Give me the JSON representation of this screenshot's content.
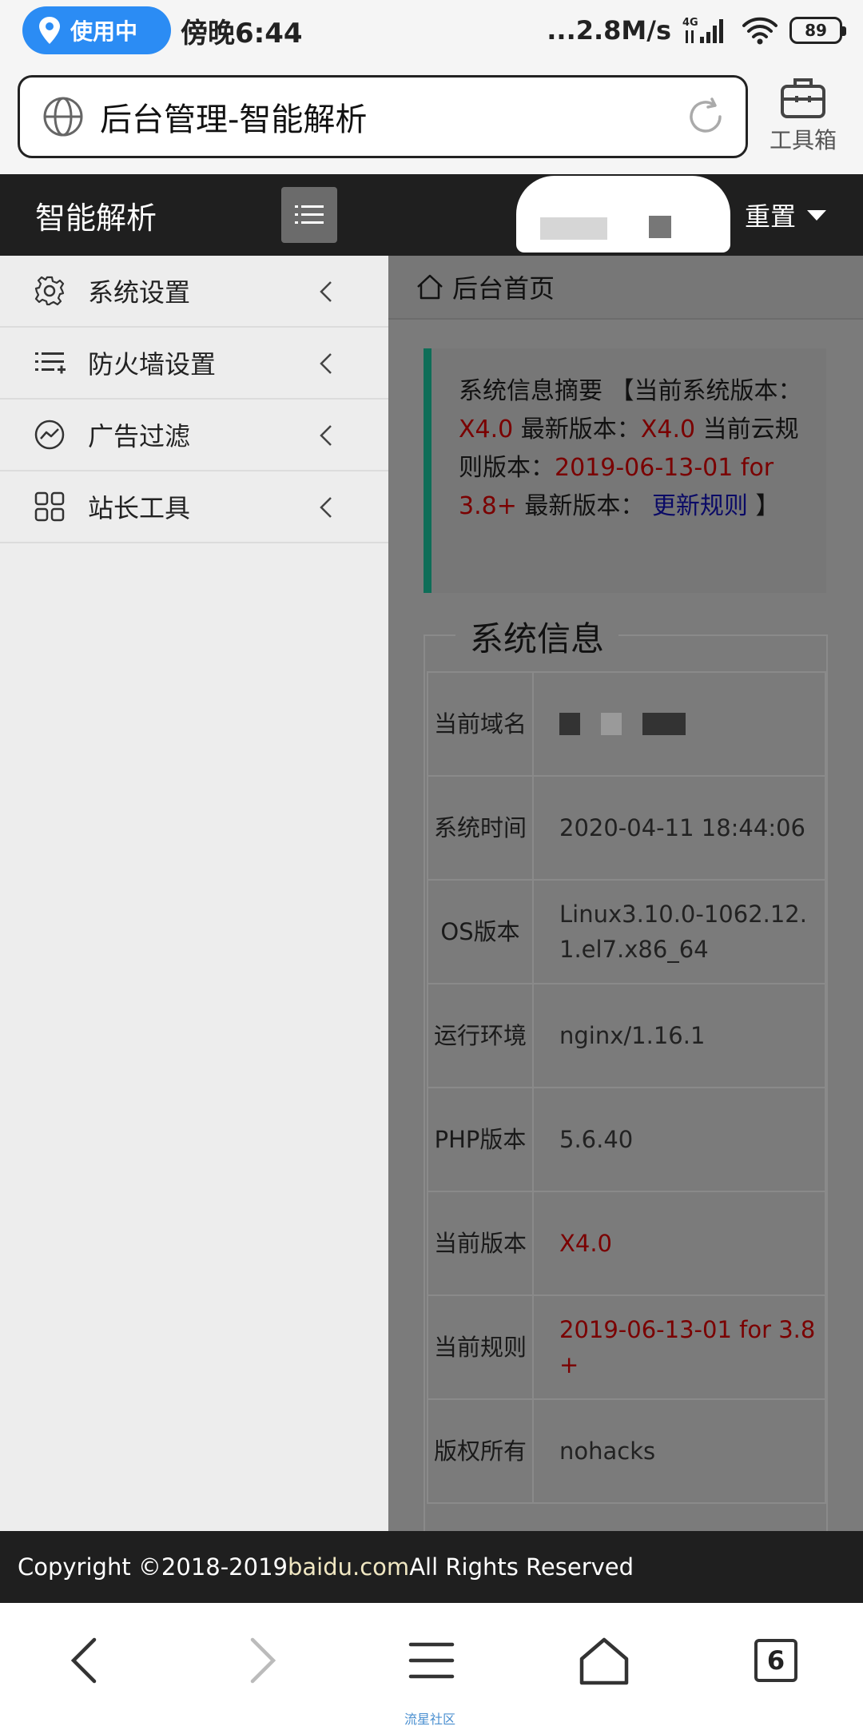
{
  "status_bar": {
    "location_label": "使用中",
    "time": "傍晚6:44",
    "network_speed": "...2.8M/s",
    "network_type": "4G",
    "battery": "89"
  },
  "browser": {
    "page_title": "后台管理-智能解析",
    "toolbox_label": "工具箱",
    "tabs_count": "6",
    "watermark": "流星社区"
  },
  "header": {
    "brand": "智能解析",
    "reset_label": "重置"
  },
  "sidebar": {
    "items": [
      {
        "label": "系统设置",
        "icon": "gear-icon"
      },
      {
        "label": "防火墙设置",
        "icon": "list-add-icon"
      },
      {
        "label": "广告过滤",
        "icon": "trend-icon"
      },
      {
        "label": "站长工具",
        "icon": "grid-icon"
      }
    ]
  },
  "main": {
    "breadcrumb": "后台首页",
    "notice": {
      "prefix": "系统信息摘要 【当前系统版本：",
      "current_version": "X4.0",
      "latest_label": " 最新版本：",
      "latest_version": "X4.0",
      "rules_label": " 当前云规则版本：",
      "rules_version": "2019-06-13-01 for 3.8+",
      "latest_rules_label": " 最新版本： ",
      "update_link": "更新规则",
      "suffix": " 】"
    },
    "info_title": "系统信息",
    "info_rows": [
      {
        "key": "当前域名",
        "value": ""
      },
      {
        "key": "系统时间",
        "value": "2020-04-11 18:44:06"
      },
      {
        "key": "OS版本",
        "value": "Linux3.10.0-1062.12.1.el7.x86_64"
      },
      {
        "key": "运行环境",
        "value": "nginx/1.16.1"
      },
      {
        "key": "PHP版本",
        "value": "5.6.40"
      },
      {
        "key": "当前版本",
        "value": "X4.0"
      },
      {
        "key": "当前规则",
        "value": "2019-06-13-01 for 3.8+"
      },
      {
        "key": "版权所有",
        "value": "nohacks"
      }
    ]
  },
  "footer": {
    "prefix": "Copyright ©2018-2019 ",
    "link": "baidu.com",
    "suffix": " All Rights Reserved"
  },
  "colors": {
    "accent_blue": "#2b8cf4",
    "header_bg": "#1f1f1f",
    "notice_border": "#0e6e58",
    "highlight_red": "#7a0000",
    "link_blue": "#0a0a66"
  }
}
